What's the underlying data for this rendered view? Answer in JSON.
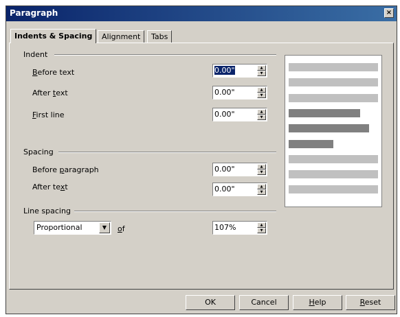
{
  "window": {
    "title": "Paragraph",
    "close_glyph": "×"
  },
  "tabs": [
    {
      "label": "Indents & Spacing"
    },
    {
      "label": "Alignment"
    },
    {
      "label": "Tabs"
    }
  ],
  "indent": {
    "title": "Indent",
    "before_text": {
      "label_key": "B",
      "label_rest": "efore text",
      "value": "0.00\""
    },
    "after_text": {
      "label_pre": "After ",
      "label_key": "t",
      "label_rest": "ext",
      "value": "0.00\""
    },
    "first_line": {
      "label_key": "F",
      "label_rest": "irst line",
      "value": "0.00\""
    }
  },
  "spacing": {
    "title": "Spacing",
    "before_paragraph": {
      "label_pre": "Before ",
      "label_key": "p",
      "label_rest": "aragraph",
      "value": "0.00\""
    },
    "after_text": {
      "label_pre": "After te",
      "label_key": "x",
      "label_rest": "t",
      "value": "0.00\""
    }
  },
  "line_spacing": {
    "title": "Line spacing",
    "mode": "Proportional",
    "of_key": "o",
    "of_rest": "f",
    "value": "107%"
  },
  "preview": {
    "colors": {
      "light": "#c0c0c0",
      "dark": "#808080"
    },
    "lines": [
      {
        "kind": "light",
        "length": 1.0
      },
      {
        "kind": "light",
        "length": 1.0
      },
      {
        "kind": "light",
        "length": 1.0
      },
      {
        "kind": "dark",
        "length": 0.8
      },
      {
        "kind": "dark",
        "length": 0.9
      },
      {
        "kind": "dark",
        "length": 0.5
      },
      {
        "kind": "light",
        "length": 1.0
      },
      {
        "kind": "light",
        "length": 1.0
      },
      {
        "kind": "light",
        "length": 1.0
      }
    ]
  },
  "buttons": {
    "ok": "OK",
    "cancel": "Cancel",
    "help_key": "H",
    "help_rest": "elp",
    "reset_key": "R",
    "reset_rest": "eset"
  }
}
